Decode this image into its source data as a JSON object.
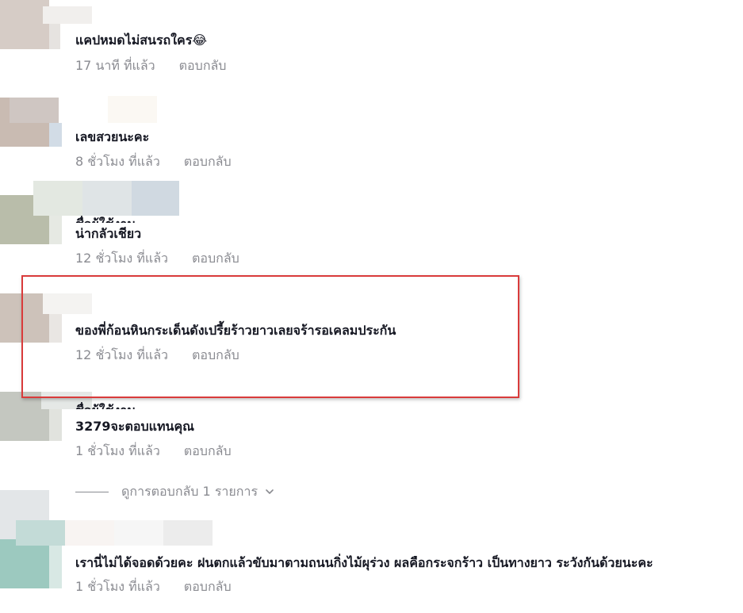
{
  "comments": [
    {
      "text": "แคปหมดไม่สนรถใคร",
      "emoji": "😂",
      "time": "17 นาที ที่แล้ว",
      "reply": "ตอบกลับ"
    },
    {
      "text": "เลขสวยนะคะ",
      "time": "8 ชั่วโมง ที่แล้ว",
      "reply": "ตอบกลับ"
    },
    {
      "text": "น่ากลัวเชียว",
      "time": "12 ชั่วโมง ที่แล้ว",
      "reply": "ตอบกลับ"
    },
    {
      "text": "ของพี่ก้อนหินกระเด็นดังเปรี้ยร้าวยาวเลยจร้ารอเคลมประกัน",
      "time": "12 ชั่วโมง ที่แล้ว",
      "reply": "ตอบกลับ"
    },
    {
      "text": "3279จะตอบแทนคุณ",
      "time": "1 ชั่วโมง ที่แล้ว",
      "reply": "ตอบกลับ"
    },
    {
      "text": "เรานี่ไม่ได้จอดด้วยคะ ฝนตกแล้วขับมาตามถนนกิ่งไม้ผุร่วง ผลคือกระจกร้าว เป็นทางยาว ระวังกันด้วยนะคะ",
      "time": "1 ชั่วโมง ที่แล้ว",
      "reply": "ตอบกลับ"
    }
  ],
  "view_replies": {
    "label": "ดูการตอบกลับ 1 รายการ",
    "icon": "chevron-down-icon"
  },
  "colors": {
    "text": "#161823",
    "meta": "#8a8b91",
    "highlight_border": "#d93b3b"
  }
}
